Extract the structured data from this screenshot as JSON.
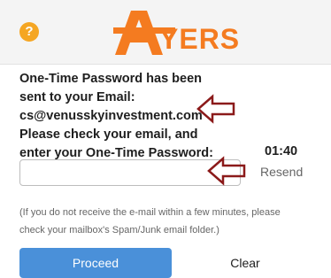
{
  "header": {
    "help_glyph": "?",
    "logo_text": "AYERS",
    "brand_color": "#f47b20",
    "help_color": "#f5a623"
  },
  "message": {
    "line1": "One-Time Password has been",
    "line2": "sent to your Email:",
    "email": "cs@venusskyinvestment.com",
    "line4": "Please check your email, and",
    "line5": "enter your One-Time Password:"
  },
  "timer": "01:40",
  "otp_input": {
    "value": "",
    "placeholder": ""
  },
  "resend_label": "Resend",
  "note": {
    "line1": "(If you do not receive the e-mail within a few minutes, please",
    "line2": "check your mailbox's Spam/Junk email folder.)"
  },
  "buttons": {
    "proceed": "Proceed",
    "clear": "Clear",
    "proceed_color": "#4a90d9"
  },
  "annotation": {
    "arrow_color": "#8b1a1a"
  }
}
